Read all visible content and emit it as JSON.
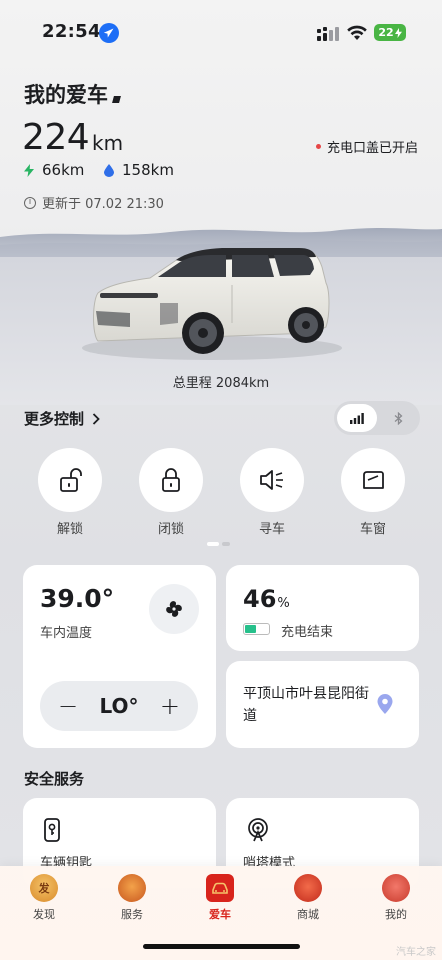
{
  "status_bar": {
    "time": "22:54",
    "battery": "22"
  },
  "vehicle": {
    "title": "我的爱车",
    "range_value": "224",
    "range_unit": "km",
    "charge_port_status": "充电口盖已开启",
    "electric_range": "66km",
    "fuel_range": "158km",
    "update_text": "更新于 07.02 21:30",
    "odometer": "总里程 2084km"
  },
  "controls": {
    "more_label": "更多控制",
    "items": [
      {
        "label": "解锁",
        "icon": "unlock-icon"
      },
      {
        "label": "闭锁",
        "icon": "lock-icon"
      },
      {
        "label": "寻车",
        "icon": "horn-icon"
      },
      {
        "label": "车窗",
        "icon": "window-icon"
      }
    ]
  },
  "climate": {
    "temperature": "39.0°",
    "label": "车内温度",
    "minus": "−",
    "setting": "LO°",
    "plus": "+"
  },
  "battery": {
    "percent": "46",
    "unit": "%",
    "level": 0.46,
    "status": "充电结束"
  },
  "location": {
    "address": "平顶山市叶县昆阳街道"
  },
  "safety": {
    "title": "安全服务",
    "items": [
      {
        "label": "车辆钥匙",
        "icon": "car-key-icon"
      },
      {
        "label": "哨塔模式",
        "icon": "sentry-icon"
      }
    ]
  },
  "tabs": [
    {
      "label": "发现",
      "icon_text": "发",
      "color": "#e0a03a"
    },
    {
      "label": "服务",
      "icon_text": "",
      "color": "#e07b2e"
    },
    {
      "label": "爱车",
      "icon_text": "",
      "color": "#d8241c"
    },
    {
      "label": "商城",
      "icon_text": "",
      "color": "#e2492f"
    },
    {
      "label": "我的",
      "icon_text": "",
      "color": "#e0513a"
    }
  ],
  "watermark": "汽车之家",
  "colors": {
    "accent_red": "#d8241c",
    "electric_green": "#28b463",
    "fuel_blue": "#2f6ee8",
    "battery_green": "#26c08b"
  }
}
